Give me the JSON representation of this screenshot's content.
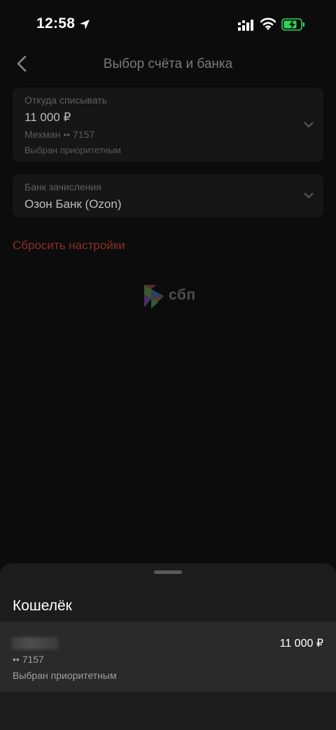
{
  "status_bar": {
    "time": "12:58"
  },
  "nav": {
    "title": "Выбор счёта и банка"
  },
  "from_account": {
    "label": "Откуда списывать",
    "amount": "11 000 ₽",
    "account_name": "Мехман •• 7157",
    "note": "Выбран приоритетным"
  },
  "bank": {
    "label": "Банк зачисления",
    "value": "Озон Банк (Ozon)"
  },
  "reset": {
    "label": "Сбросить настройки"
  },
  "logo": {
    "text": "сбп"
  },
  "sheet": {
    "title": "Кошелёк",
    "account": {
      "amount": "11 000 ₽",
      "number": "•• 7157",
      "note": "Выбран приоритетным"
    }
  },
  "colors": {
    "background": "#0c0c0c",
    "card": "#161616",
    "sheet": "#1c1c1c",
    "reset_accent": "#8a2f24",
    "battery_charge": "#2fd158"
  }
}
